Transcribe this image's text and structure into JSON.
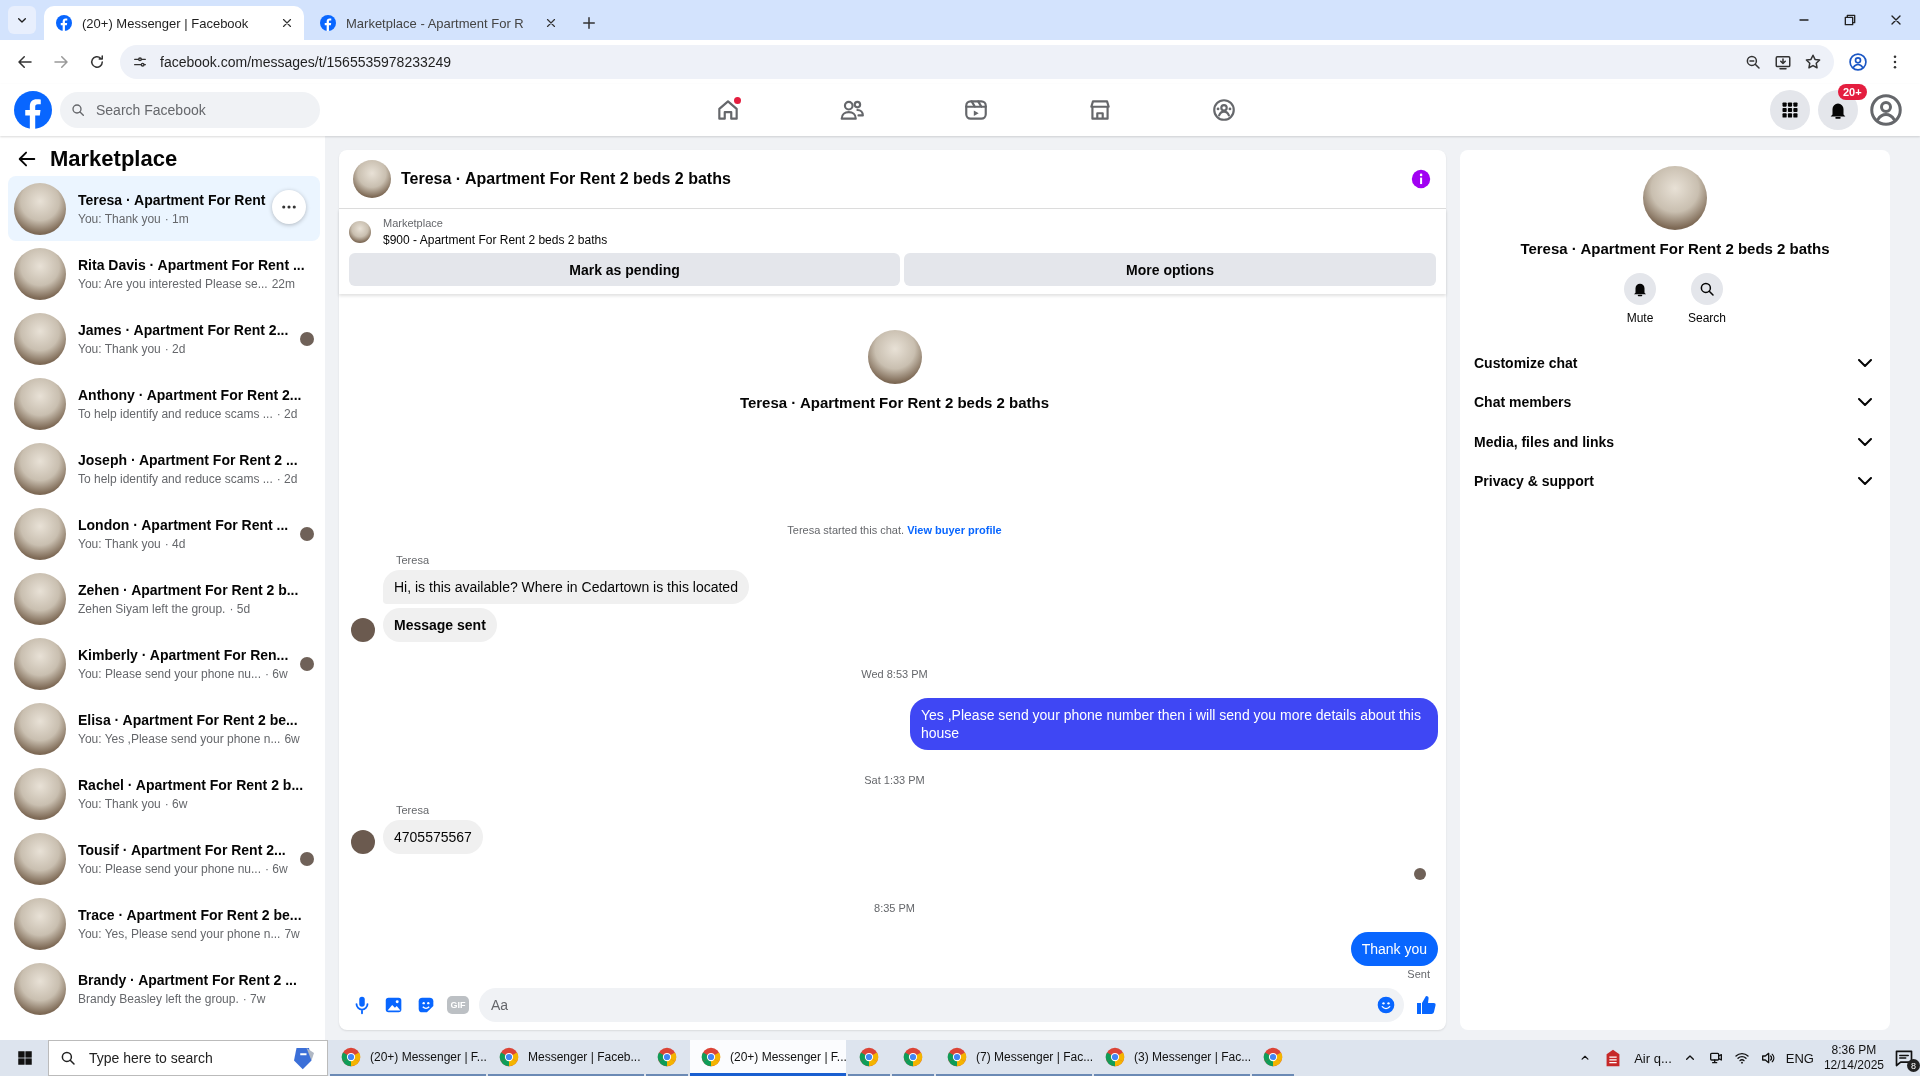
{
  "browser": {
    "tabs": [
      {
        "title": "(20+) Messenger | Facebook",
        "selected": true
      },
      {
        "title": "Marketplace - Apartment For R",
        "selected": false
      }
    ],
    "url": "facebook.com/messages/t/1565535978233249"
  },
  "header": {
    "search_placeholder": "Search Facebook",
    "nav": [
      {
        "kind": "home",
        "selected": false,
        "dot": true
      },
      {
        "kind": "friends",
        "selected": false,
        "dot": false
      },
      {
        "kind": "video",
        "selected": false,
        "dot": false
      },
      {
        "kind": "store",
        "selected": false,
        "dot": false
      },
      {
        "kind": "groups",
        "selected": false,
        "dot": false
      }
    ],
    "notifications_badge": "20+"
  },
  "sidebar": {
    "title": "Marketplace",
    "conversations": [
      {
        "name": "Teresa · Apartment For Rent",
        "preview": "You: Thank you",
        "time": "· 1m",
        "selected": true,
        "seen": false
      },
      {
        "name": "Rita Davis · Apartment For Rent ...",
        "preview": "You: Are you interested Please se...",
        "time": "22m",
        "selected": false,
        "seen": false
      },
      {
        "name": "James · Apartment For Rent 2...",
        "preview": "You: Thank you",
        "time": "· 2d",
        "selected": false,
        "seen": true
      },
      {
        "name": "Anthony · Apartment For Rent 2...",
        "preview": "To help identify and reduce scams ...",
        "time": "· 2d",
        "selected": false,
        "seen": false
      },
      {
        "name": "Joseph · Apartment For Rent 2 ...",
        "preview": "To help identify and reduce scams ...",
        "time": "· 2d",
        "selected": false,
        "seen": false
      },
      {
        "name": "London · Apartment For Rent ...",
        "preview": "You: Thank you",
        "time": "· 4d",
        "selected": false,
        "seen": true
      },
      {
        "name": "Zehen · Apartment For Rent 2 b...",
        "preview": "Zehen Siyam left the group.",
        "time": "· 5d",
        "selected": false,
        "seen": false
      },
      {
        "name": "Kimberly · Apartment For Ren...",
        "preview": "You: Please send your phone nu...",
        "time": "· 6w",
        "selected": false,
        "seen": true
      },
      {
        "name": "Elisa · Apartment For Rent 2 be...",
        "preview": "You: Yes ,Please send your phone n...",
        "time": "6w",
        "selected": false,
        "seen": false
      },
      {
        "name": "Rachel · Apartment For Rent 2 b...",
        "preview": "You: Thank you",
        "time": "· 6w",
        "selected": false,
        "seen": false
      },
      {
        "name": "Tousif · Apartment For Rent 2...",
        "preview": "You: Please send your phone nu...",
        "time": "· 6w",
        "selected": false,
        "seen": true
      },
      {
        "name": "Trace · Apartment For Rent 2 be...",
        "preview": "You: Yes, Please send your phone n...",
        "time": "7w",
        "selected": false,
        "seen": false
      },
      {
        "name": "Brandy · Apartment For Rent 2 ...",
        "preview": "Brandy Beasley left the group.",
        "time": "· 7w",
        "selected": false,
        "seen": false
      }
    ]
  },
  "chat": {
    "title": "Teresa · Apartment For Rent 2 beds 2 baths",
    "listing": {
      "label": "Marketplace",
      "title": "$900 - Apartment For Rent 2 beds 2 baths"
    },
    "actions": [
      "Mark as pending",
      "More options"
    ],
    "intro_title": "Teresa · Apartment For Rent 2 beds 2 baths",
    "messages": [
      {
        "kind": "system",
        "text": "Teresa started this chat.",
        "link": "View buyer profile"
      },
      {
        "kind": "sender",
        "text": "Teresa"
      },
      {
        "kind": "incoming",
        "text": "Hi, is this available? Where in Cedartown is this located",
        "avatar": false,
        "bold": false
      },
      {
        "kind": "incoming",
        "text": "Message sent",
        "avatar": true,
        "bold": true
      },
      {
        "kind": "time",
        "text": "Wed 8:53 PM"
      },
      {
        "kind": "outgoing",
        "text": "Yes ,Please send your phone number then i will send you more details about this house",
        "color": "#3f47f4"
      },
      {
        "kind": "time",
        "text": "Sat 1:33 PM"
      },
      {
        "kind": "sender",
        "text": "Teresa"
      },
      {
        "kind": "incoming",
        "text": "4705575567",
        "avatar": true,
        "bold": false
      },
      {
        "kind": "seen"
      },
      {
        "kind": "time",
        "text": "8:35 PM"
      },
      {
        "kind": "outgoing",
        "text": "Thank you",
        "color": "#0866ff"
      },
      {
        "kind": "status",
        "text": "Sent"
      }
    ],
    "composer": {
      "gif": "GIF",
      "placeholder": "Aa"
    }
  },
  "details": {
    "name": "Teresa · Apartment For Rent 2 beds 2 baths",
    "actions": [
      {
        "kind": "bell",
        "label": "Mute"
      },
      {
        "kind": "search",
        "label": "Search"
      }
    ],
    "sections": [
      {
        "label": "Customize chat",
        "expanded": false
      },
      {
        "label": "Chat members",
        "expanded": false
      },
      {
        "label": "Media, files and links",
        "expanded": false
      },
      {
        "label": "Privacy & support",
        "expanded": false
      }
    ]
  },
  "taskbar": {
    "search_placeholder": "Type here to search",
    "apps": [
      {
        "label": "(20+) Messenger | F...",
        "selected": false
      },
      {
        "label": "Messenger | Faceb...",
        "selected": false
      },
      {
        "selected": false
      },
      {
        "label": "(20+) Messenger | F...",
        "selected": true
      },
      {
        "selected": false
      },
      {
        "selected": false
      },
      {
        "label": "(7) Messenger | Fac...",
        "selected": false
      },
      {
        "label": "(3) Messenger | Fac...",
        "selected": false
      },
      {
        "selected": false
      }
    ],
    "weather": "Air q...",
    "language": "ENG",
    "time": "8:36 PM",
    "date": "12/14/2025",
    "notifications": "8"
  }
}
